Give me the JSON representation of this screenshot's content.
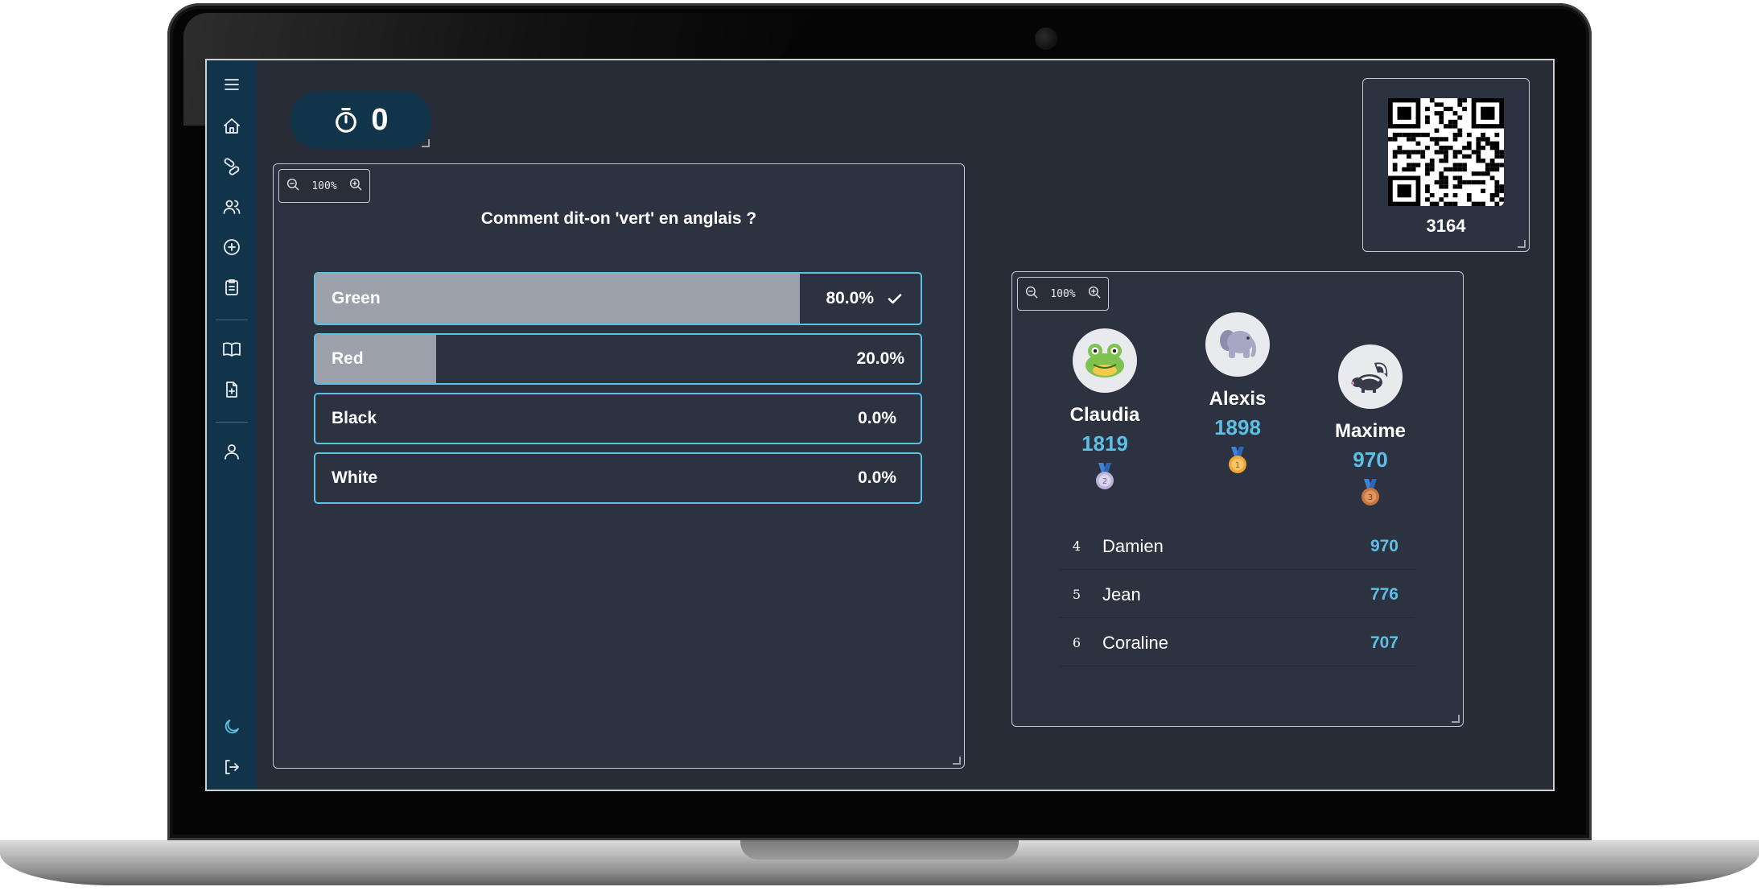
{
  "timer": {
    "value": "0"
  },
  "question": {
    "zoom": "100%",
    "text": "Comment dit-on 'vert' en anglais ?",
    "answers": [
      {
        "label": "Green",
        "percent_text": "80.0%",
        "fraction": 0.8,
        "correct": true
      },
      {
        "label": "Red",
        "percent_text": "20.0%",
        "fraction": 0.2,
        "correct": false
      },
      {
        "label": "Black",
        "percent_text": "0.0%",
        "fraction": 0.0,
        "correct": false
      },
      {
        "label": "White",
        "percent_text": "0.0%",
        "fraction": 0.0,
        "correct": false
      }
    ]
  },
  "room": {
    "code": "3164"
  },
  "leaderboard": {
    "zoom": "100%",
    "podium": [
      {
        "name": "Claudia",
        "score": "1819",
        "rank": "2",
        "avatar": "frog-icon"
      },
      {
        "name": "Alexis",
        "score": "1898",
        "rank": "1",
        "avatar": "elephant-icon"
      },
      {
        "name": "Maxime",
        "score": "970",
        "rank": "3",
        "avatar": "skunk-icon"
      }
    ],
    "rows": [
      {
        "rank": "4",
        "name": "Damien",
        "score": "970"
      },
      {
        "rank": "5",
        "name": "Jean",
        "score": "776"
      },
      {
        "rank": "6",
        "name": "Coraline",
        "score": "707"
      }
    ]
  },
  "colors": {
    "accent": "#5cc0e6",
    "sidebar": "#11344a",
    "background": "#282c37",
    "answer_fill": "#9ca0aa",
    "medal_gold": "#f0a63a",
    "medal_silver": "#b9b3d8",
    "medal_bronze": "#c9743f"
  },
  "sidebar_icons": [
    "menu-icon",
    "home-icon",
    "pill-icon",
    "users-icon",
    "plus-circle-icon",
    "clipboard-icon",
    "book-icon",
    "file-plus-icon",
    "user-icon",
    "moon-icon",
    "logout-icon"
  ]
}
